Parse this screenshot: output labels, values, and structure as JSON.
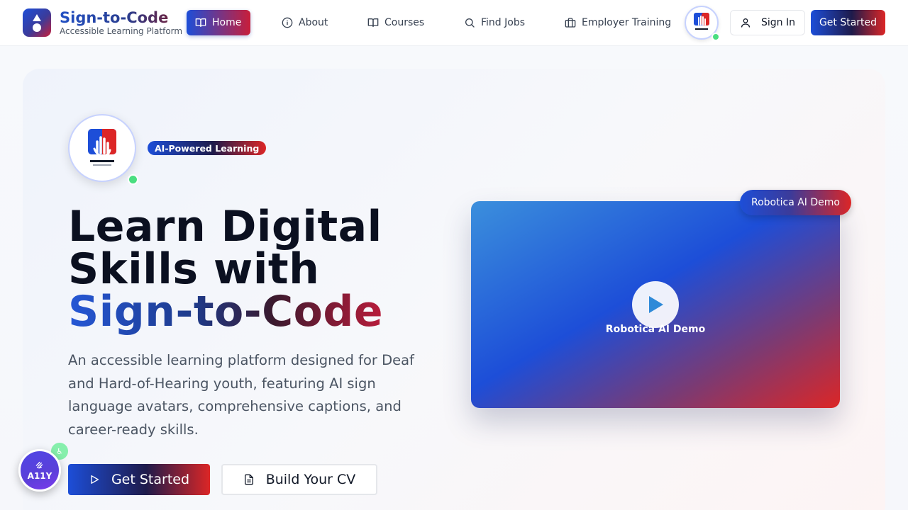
{
  "brand": {
    "name": "Sign-to-Code",
    "tagline": "Accessible Learning Platform"
  },
  "nav": {
    "items": [
      {
        "label": "Home",
        "icon": "book-open-icon",
        "active": true
      },
      {
        "label": "About",
        "icon": "info-icon"
      },
      {
        "label": "Courses",
        "icon": "book-open-icon"
      },
      {
        "label": "Find Jobs",
        "icon": "search-icon"
      },
      {
        "label": "Employer Training",
        "icon": "briefcase-icon"
      }
    ],
    "sign_in": "Sign In",
    "get_started": "Get Started"
  },
  "hero": {
    "badge": "AI-Powered Learning",
    "headline_line1": "Learn Digital",
    "headline_line2": "Skills with",
    "headline_brand": "Sign-to-Code",
    "description": "An accessible learning platform designed for Deaf and Hard-of-Hearing youth, featuring AI sign language avatars, comprehensive captions, and career-ready skills.",
    "primary_button": "Get Started",
    "secondary_button": "Build Your CV",
    "video": {
      "tag": "Robotica AI Demo",
      "label": "Robotica AI Demo"
    }
  },
  "accessibility_widget": {
    "label": "A11Y"
  },
  "colors": {
    "brand_blue": "#1d4ed8",
    "brand_red": "#dc2626",
    "online_green": "#4ade80"
  }
}
